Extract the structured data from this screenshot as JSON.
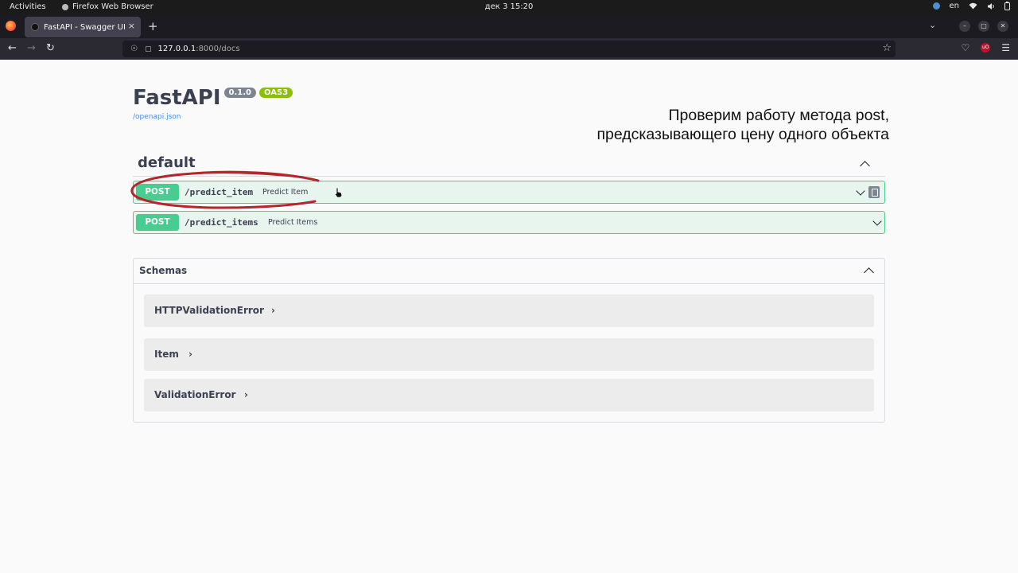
{
  "system_bar": {
    "activities": "Activities",
    "app_name": "Firefox Web Browser",
    "clock": "дек 3  15:20",
    "language": "en"
  },
  "browser": {
    "tab_title": "FastAPI - Swagger UI",
    "tab_close": "×",
    "new_tab": "+",
    "url_host": "127.0.0.1",
    "url_rest": ":8000/docs"
  },
  "header": {
    "title": "FastAPI",
    "version": "0.1.0",
    "oas": "OAS3",
    "openapi_link": "/openapi.json"
  },
  "annotation": {
    "line1": "Проверим работу метода post,",
    "line2": "предсказывающего цену одного объекта"
  },
  "section": {
    "name": "default",
    "operations": [
      {
        "method": "POST",
        "path": "/predict_item",
        "summary": "Predict Item"
      },
      {
        "method": "POST",
        "path": "/predict_items",
        "summary": "Predict Items"
      }
    ]
  },
  "schemas": {
    "label": "Schemas",
    "models": [
      {
        "name": "HTTPValidationError",
        "chevron": "›"
      },
      {
        "name": "Item",
        "chevron": "›"
      },
      {
        "name": "ValidationError",
        "chevron": "›"
      }
    ]
  },
  "colors": {
    "post_method": "#49cc90",
    "post_background": "#e8f4ee",
    "version_badge": "#7d8492",
    "oas_badge": "#89bf04",
    "annotation_stroke": "#b3272c"
  }
}
